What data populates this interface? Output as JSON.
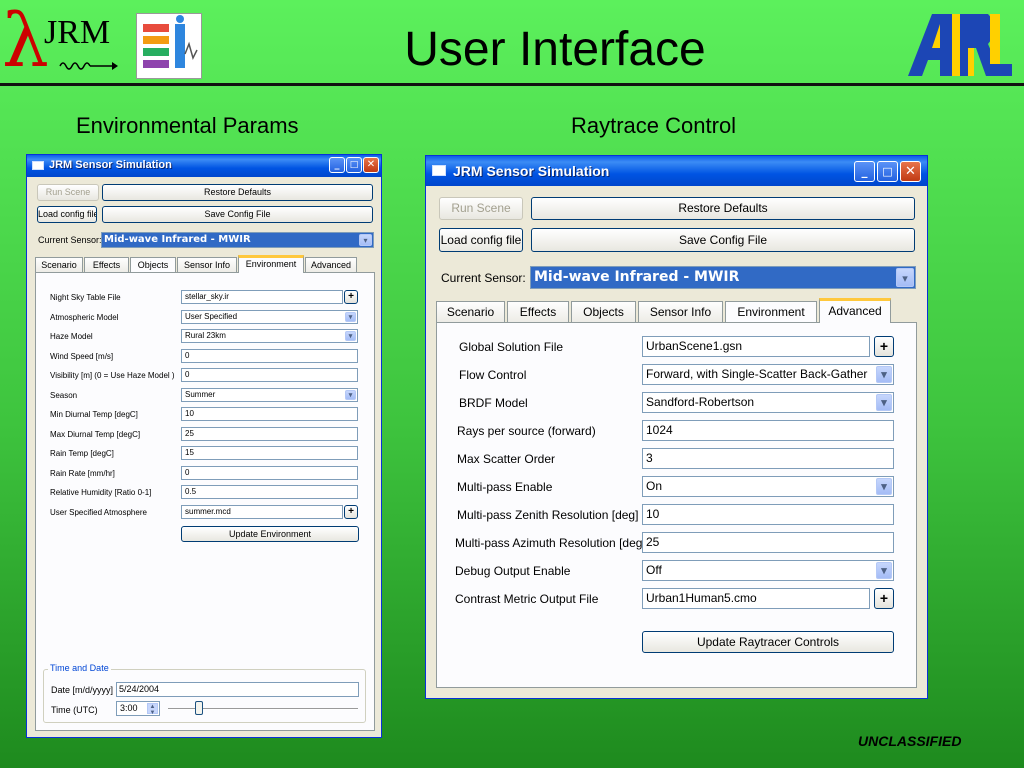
{
  "slide": {
    "title": "User Interface",
    "left_heading": "Environmental Params",
    "right_heading": "Raytrace Control",
    "classification": "UNCLASSIFIED"
  },
  "logos": {
    "jrm_text": "JRM",
    "jrm_lambda": "λ"
  },
  "left_window": {
    "title": "JRM Sensor Simulation",
    "run_scene": "Run Scene",
    "restore_defaults": "Restore Defaults",
    "load_config": "Load config file",
    "save_config": "Save Config File",
    "current_sensor_label": "Current Sensor:",
    "current_sensor_value": "Mid-wave Infrared - MWIR",
    "tabs": [
      "Scenario",
      "Effects",
      "Objects",
      "Sensor Info",
      "Environment",
      "Advanced"
    ],
    "active_tab": "Environment",
    "fields": [
      {
        "label": "Night Sky Table File",
        "value": "stellar_sky.ir",
        "kind": "file"
      },
      {
        "label": "Atmospheric Model",
        "value": "User Specified",
        "kind": "combo"
      },
      {
        "label": "Haze Model",
        "value": "Rural 23km",
        "kind": "combo"
      },
      {
        "label": "Wind Speed [m/s]",
        "value": "0",
        "kind": "text"
      },
      {
        "label": "Visibility [m] (0 = Use Haze Model )",
        "value": "0",
        "kind": "text"
      },
      {
        "label": "Season",
        "value": "Summer",
        "kind": "combo"
      },
      {
        "label": "Min Diurnal Temp [degC]",
        "value": "10",
        "kind": "text"
      },
      {
        "label": "Max Diurnal Temp [degC]",
        "value": "25",
        "kind": "text"
      },
      {
        "label": "Rain Temp [degC]",
        "value": "15",
        "kind": "text"
      },
      {
        "label": "Rain Rate [mm/hr]",
        "value": "0",
        "kind": "text"
      },
      {
        "label": "Relative Humidity [Ratio 0-1]",
        "value": "0.5",
        "kind": "text"
      },
      {
        "label": "User Specified Atmosphere",
        "value": "summer.mcd",
        "kind": "file"
      }
    ],
    "update_button": "Update Environment",
    "time_group_title": "Time and Date",
    "date_label": "Date [m/d/yyyy]",
    "date_value": "5/24/2004",
    "time_label": "Time (UTC)",
    "time_value": "3:00",
    "time_slider_level": 0.14
  },
  "right_window": {
    "title": "JRM Sensor Simulation",
    "run_scene": "Run Scene",
    "restore_defaults": "Restore Defaults",
    "load_config": "Load config file",
    "save_config": "Save Config File",
    "current_sensor_label": "Current Sensor:",
    "current_sensor_value": "Mid-wave Infrared - MWIR",
    "tabs": [
      "Scenario",
      "Effects",
      "Objects",
      "Sensor Info",
      "Environment",
      "Advanced"
    ],
    "active_tab": "Advanced",
    "fields": [
      {
        "label": "Global Solution File",
        "value": "UrbanScene1.gsn",
        "kind": "file"
      },
      {
        "label": "Flow Control",
        "value": "Forward, with Single-Scatter Back-Gather",
        "kind": "combo"
      },
      {
        "label": "BRDF Model",
        "value": "Sandford-Robertson",
        "kind": "combo"
      },
      {
        "label": "Rays per source (forward)",
        "value": "1024",
        "kind": "text"
      },
      {
        "label": "Max Scatter Order",
        "value": "3",
        "kind": "text"
      },
      {
        "label": "Multi-pass Enable",
        "value": "On",
        "kind": "combo"
      },
      {
        "label": "Multi-pass Zenith Resolution [deg]",
        "value": "10",
        "kind": "text"
      },
      {
        "label": "Multi-pass Azimuth Resolution [deg]",
        "value": "25",
        "kind": "text"
      },
      {
        "label": "Debug Output Enable",
        "value": "Off",
        "kind": "combo"
      },
      {
        "label": "Contrast Metric Output File",
        "value": "Urban1Human5.cmo",
        "kind": "file"
      }
    ],
    "update_button": "Update Raytracer Controls"
  },
  "colors": {
    "titlebar_blue": "#0054e3",
    "selection_blue": "#316ac5",
    "active_tab_accent": "#ffc83c",
    "slide_green": "#3ec43e"
  }
}
